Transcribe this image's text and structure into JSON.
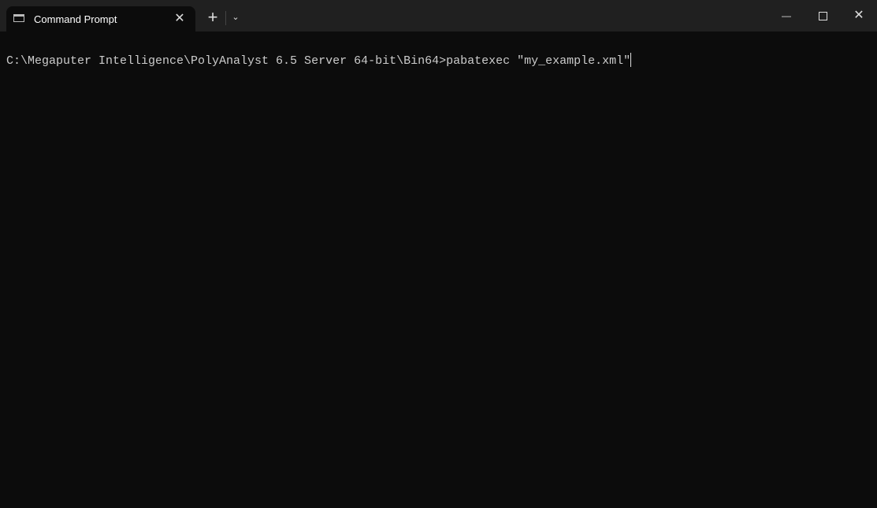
{
  "tab": {
    "title": "Command Prompt",
    "icon": "cmd-icon",
    "close": "✕"
  },
  "titlebar": {
    "new_tab": "+",
    "dropdown": "⌄",
    "minimize": "—",
    "maximize": "☐",
    "close": "✕"
  },
  "terminal": {
    "prompt": "C:\\Megaputer Intelligence\\PolyAnalyst 6.5 Server 64-bit\\Bin64>",
    "command": "pabatexec \"my_example.xml\""
  }
}
